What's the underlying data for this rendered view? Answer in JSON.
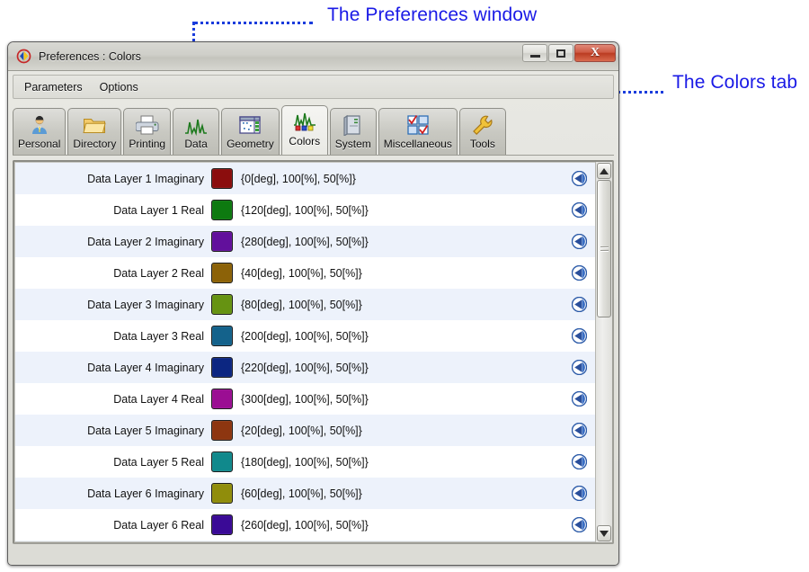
{
  "annotations": [
    {
      "id": "pref-window",
      "text": "The Preferences window"
    },
    {
      "id": "colors-tab",
      "text": "The Colors tab"
    }
  ],
  "window": {
    "title": "Preferences : Colors",
    "icon": "app-icon",
    "controls": {
      "minimize": "minimize-button",
      "maximize": "maximize-button",
      "close": "X"
    }
  },
  "menubar": {
    "items": [
      {
        "label": "Parameters"
      },
      {
        "label": "Options"
      }
    ]
  },
  "tabs": [
    {
      "label": "Personal",
      "icon": "user-icon",
      "selected": false
    },
    {
      "label": "Directory",
      "icon": "folder-icon",
      "selected": false
    },
    {
      "label": "Printing",
      "icon": "printer-icon",
      "selected": false
    },
    {
      "label": "Data",
      "icon": "chart-peaks-icon",
      "selected": false
    },
    {
      "label": "Geometry",
      "icon": "grid-table-icon",
      "selected": false
    },
    {
      "label": "Colors",
      "icon": "color-peaks-icon",
      "selected": true
    },
    {
      "label": "System",
      "icon": "server-icon",
      "selected": false
    },
    {
      "label": "Miscellaneous",
      "icon": "checkboxes-icon",
      "selected": false
    },
    {
      "label": "Tools",
      "icon": "wrench-icon",
      "selected": false
    }
  ],
  "list": {
    "action_icon": "revert-arrow-icon",
    "rows": [
      {
        "label": "Data Layer 1 Imaginary",
        "color": "#8b0d0d",
        "value": "{0[deg], 100[%], 50[%]}"
      },
      {
        "label": "Data Layer 1 Real",
        "color": "#0d7a10",
        "value": "{120[deg], 100[%], 50[%]}"
      },
      {
        "label": "Data Layer 2 Imaginary",
        "color": "#62109c",
        "value": "{280[deg], 100[%], 50[%]}"
      },
      {
        "label": "Data Layer 2 Real",
        "color": "#8c6208",
        "value": "{40[deg], 100[%], 50[%]}"
      },
      {
        "label": "Data Layer 3 Imaginary",
        "color": "#669312",
        "value": "{80[deg], 100[%], 50[%]}"
      },
      {
        "label": "Data Layer 3 Real",
        "color": "#14628b",
        "value": "{200[deg], 100[%], 50[%]}"
      },
      {
        "label": "Data Layer 4 Imaginary",
        "color": "#0c2681",
        "value": "{220[deg], 100[%], 50[%]}"
      },
      {
        "label": "Data Layer 4 Real",
        "color": "#9b0e93",
        "value": "{300[deg], 100[%], 50[%]}"
      },
      {
        "label": "Data Layer 5 Imaginary",
        "color": "#8d3610",
        "value": "{20[deg], 100[%], 50[%]}"
      },
      {
        "label": "Data Layer 5 Real",
        "color": "#10898c",
        "value": "{180[deg], 100[%], 50[%]}"
      },
      {
        "label": "Data Layer 6 Imaginary",
        "color": "#908d0b",
        "value": "{60[deg], 100[%], 50[%]}"
      },
      {
        "label": "Data Layer 6 Real",
        "color": "#3a0a96",
        "value": "{260[deg], 100[%], 50[%]}"
      }
    ]
  },
  "scrollbar": {
    "up": "scroll-up-button",
    "down": "scroll-down-button",
    "thumb_top_percent": 0,
    "thumb_height_percent": 40
  },
  "colors": {
    "annotation": "#1a1ae6",
    "row_alt_bg": "#edf2fb",
    "close_button": "#bb3c22"
  }
}
